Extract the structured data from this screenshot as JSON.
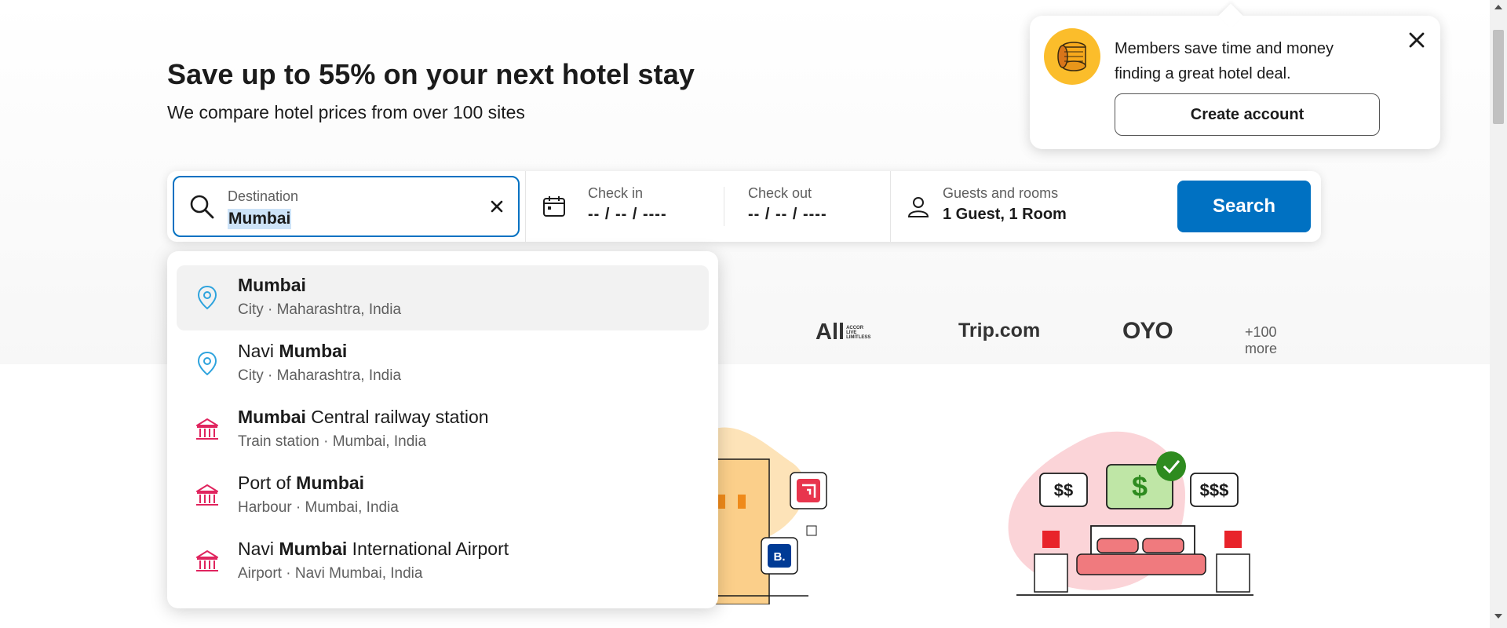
{
  "hero": {
    "title": "Save up to 55% on your next hotel stay",
    "subtitle": "We compare hotel prices from over 100 sites"
  },
  "search": {
    "destination_label": "Destination",
    "destination_value": "Mumbai",
    "checkin_label": "Check in",
    "checkin_value": "-- / -- / ----",
    "checkout_label": "Check out",
    "checkout_value": "-- / -- / ----",
    "guests_label": "Guests and rooms",
    "guests_value": "1 Guest, 1 Room",
    "search_button": "Search"
  },
  "suggestions": [
    {
      "pre": "",
      "match": "Mumbai",
      "post": "",
      "sub": "City · Maharashtra, India",
      "icon": "location-pin-icon"
    },
    {
      "pre": "Navi ",
      "match": "Mumbai",
      "post": "",
      "sub": "City · Maharashtra, India",
      "icon": "location-pin-icon"
    },
    {
      "pre": "",
      "match": "Mumbai",
      "post": " Central railway station",
      "sub": "Train station · Mumbai, India",
      "icon": "landmark-icon"
    },
    {
      "pre": "Port of ",
      "match": "Mumbai",
      "post": "",
      "sub": "Harbour · Mumbai, India",
      "icon": "landmark-icon"
    },
    {
      "pre": "Navi ",
      "match": "Mumbai",
      "post": " International Airport",
      "sub": "Airport · Navi Mumbai, India",
      "icon": "landmark-icon"
    }
  ],
  "partners": {
    "all": "All",
    "all_tagline": "ACCOR LIVE LIMITLESS",
    "trip": "Trip.com",
    "oyo": "OYO",
    "more": "+100 more"
  },
  "illustration": {
    "price_low": "$$",
    "price_mid": "$",
    "price_high": "$$$",
    "badge_b": "B."
  },
  "popup": {
    "message": "Members save time and money finding a great hotel deal.",
    "button": "Create account"
  },
  "colors": {
    "accent": "#0071c2",
    "highlight": "#cde3f8",
    "pin": "#2ea3dd",
    "landmark": "#e0245e"
  }
}
